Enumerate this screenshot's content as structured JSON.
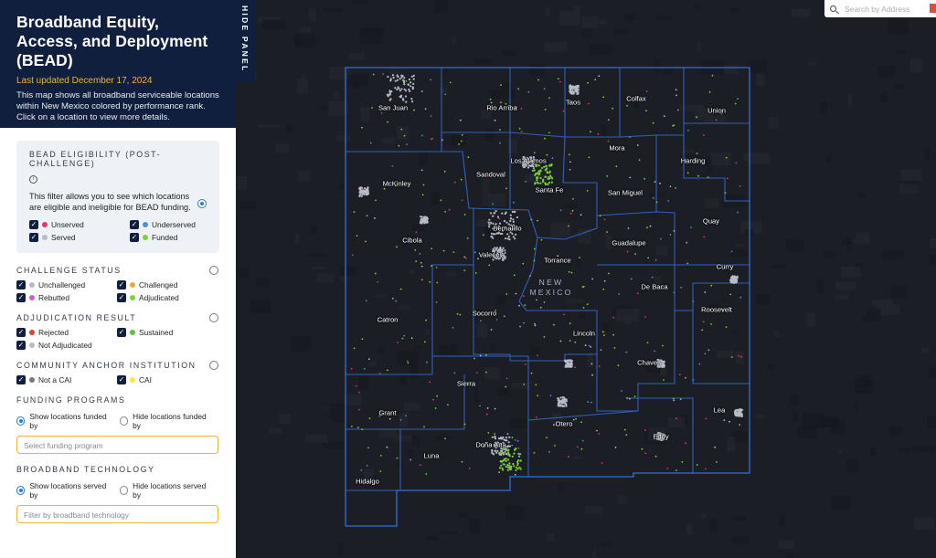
{
  "header": {
    "title": "Broadband Equity, Access, and Deployment (BEAD)",
    "updated": "Last updated December 17, 2024",
    "description": "This map shows all broadband serviceable locations within New Mexico colored by performance rank. Click on a location to view more details."
  },
  "hide_panel_label": "HIDE PANEL",
  "eligibility": {
    "title": "BEAD ELIGIBILITY (POST-CHALLENGE)",
    "description": "This filter allows you to see which locations are eligible and ineligible for BEAD funding.",
    "items": [
      {
        "label": "Unserved",
        "color": "#e0357a"
      },
      {
        "label": "Underserved",
        "color": "#4a8fe0"
      },
      {
        "label": "Served",
        "color": "#b7bcc8"
      },
      {
        "label": "Funded",
        "color": "#7ed03a"
      }
    ]
  },
  "challenge": {
    "title": "CHALLENGE STATUS",
    "items": [
      {
        "label": "Unchallenged",
        "color": "#b7bcc8"
      },
      {
        "label": "Challenged",
        "color": "#f2a33a"
      },
      {
        "label": "Rebutted",
        "color": "#d45bd0"
      },
      {
        "label": "Adjudicated",
        "color": "#7ed03a"
      }
    ]
  },
  "adjudication": {
    "title": "ADJUDICATION RESULT",
    "items": [
      {
        "label": "Rejected",
        "color": "#e0412f"
      },
      {
        "label": "Sustained",
        "color": "#5cc63a"
      },
      {
        "label": "Not Adjudicated",
        "color": "#b7bcc8"
      }
    ]
  },
  "cai": {
    "title": "COMMUNITY ANCHOR INSTITUTION",
    "items": [
      {
        "label": "Not a CAI",
        "color": "#777777"
      },
      {
        "label": "CAI",
        "color": "#f2ea3a"
      }
    ]
  },
  "funding": {
    "title": "FUNDING PROGRAMS",
    "show_label": "Show locations funded by",
    "hide_label": "Hide locations funded by",
    "placeholder": "Select funding program"
  },
  "technology": {
    "title": "BROADBAND TECHNOLOGY",
    "show_label": "Show locations served by",
    "hide_label": "Hide locations served by",
    "placeholder": "Filter by broadband technology"
  },
  "search": {
    "placeholder": "Search by Address"
  },
  "map": {
    "state_label_line1": "NEW",
    "state_label_line2": "MEXICO",
    "counties": [
      {
        "name": "San Juan"
      },
      {
        "name": "Rio Arriba"
      },
      {
        "name": "Taos"
      },
      {
        "name": "Colfax"
      },
      {
        "name": "Union"
      },
      {
        "name": "Mora"
      },
      {
        "name": "Harding"
      },
      {
        "name": "Los Alamos"
      },
      {
        "name": "Sandoval"
      },
      {
        "name": "McKinley"
      },
      {
        "name": "Santa Fe"
      },
      {
        "name": "San Miguel"
      },
      {
        "name": "Quay"
      },
      {
        "name": "Bernalillo"
      },
      {
        "name": "Cibola"
      },
      {
        "name": "Guadalupe"
      },
      {
        "name": "Valencia"
      },
      {
        "name": "Torrance"
      },
      {
        "name": "Curry"
      },
      {
        "name": "De Baca"
      },
      {
        "name": "Roosevelt"
      },
      {
        "name": "Catron"
      },
      {
        "name": "Socorro"
      },
      {
        "name": "Lincoln"
      },
      {
        "name": "Chaves"
      },
      {
        "name": "Sierra"
      },
      {
        "name": "Lea"
      },
      {
        "name": "Grant"
      },
      {
        "name": "Otero"
      },
      {
        "name": "Eddy"
      },
      {
        "name": "Doña Ana"
      },
      {
        "name": "Luna"
      },
      {
        "name": "Hidalgo"
      }
    ]
  }
}
